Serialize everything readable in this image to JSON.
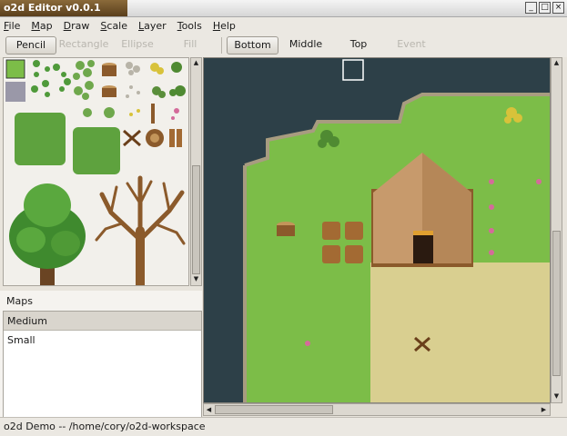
{
  "window": {
    "title": "o2d Editor v0.0.1",
    "controls": [
      "_",
      "□",
      "×"
    ]
  },
  "menu": [
    "File",
    "Map",
    "Draw",
    "Scale",
    "Layer",
    "Tools",
    "Help"
  ],
  "draw_tools": [
    {
      "label": "Pencil",
      "state": "active"
    },
    {
      "label": "Rectangle",
      "state": "disabled"
    },
    {
      "label": "Ellipse",
      "state": "disabled"
    },
    {
      "label": "Fill",
      "state": "disabled"
    }
  ],
  "layers": [
    {
      "label": "Bottom",
      "state": "active"
    },
    {
      "label": "Middle",
      "state": "normal"
    },
    {
      "label": "Top",
      "state": "normal"
    },
    {
      "label": "Event",
      "state": "disabled"
    }
  ],
  "maps": {
    "header": "Maps",
    "items": [
      "Medium",
      "Small"
    ],
    "selected": "Medium"
  },
  "status": {
    "text": "o2d Demo  --  /home/cory/o2d-workspace"
  },
  "colors": {
    "water": "#2d4048",
    "grass": "#7cbd48",
    "sand": "#d9cf90",
    "tent": "#c79a6c",
    "wood": "#8b5a2b"
  }
}
